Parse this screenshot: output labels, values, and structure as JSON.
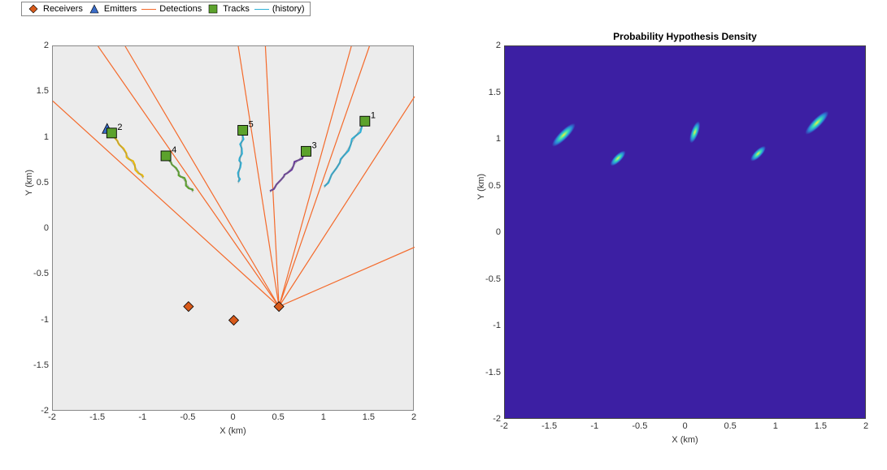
{
  "legend": {
    "items": [
      {
        "label": "Receivers"
      },
      {
        "label": "Emitters"
      },
      {
        "label": "Detections"
      },
      {
        "label": "Tracks"
      },
      {
        "label": "(history)"
      }
    ]
  },
  "left": {
    "xlabel": "X (km)",
    "ylabel": "Y (km)",
    "xticks": [
      "-2",
      "-1.5",
      "-1",
      "-0.5",
      "0",
      "0.5",
      "1",
      "1.5",
      "2"
    ],
    "yticks": [
      "-2",
      "-1.5",
      "-1",
      "-0.5",
      "0",
      "0.5",
      "1",
      "1.5",
      "2"
    ]
  },
  "right": {
    "title": "Probability Hypothesis Density",
    "xlabel": "X (km)",
    "ylabel": "Y (km)",
    "xticks": [
      "-2",
      "-1.5",
      "-1",
      "-0.5",
      "0",
      "0.5",
      "1",
      "1.5",
      "2"
    ],
    "yticks": [
      "-2",
      "-1.5",
      "-1",
      "-0.5",
      "0",
      "0.5",
      "1",
      "1.5",
      "2"
    ]
  },
  "track_labels": [
    "1",
    "2",
    "3",
    "4",
    "5"
  ],
  "chart_data": [
    {
      "type": "scatter",
      "title": "",
      "xlabel": "X (km)",
      "ylabel": "Y (km)",
      "xlim": [
        -2,
        2
      ],
      "ylim": [
        -2,
        2
      ],
      "receivers": [
        {
          "x": -0.5,
          "y": -0.85
        },
        {
          "x": 0.0,
          "y": -1.0
        },
        {
          "x": 0.5,
          "y": -0.85
        }
      ],
      "emitters": [
        {
          "x": -1.4,
          "y": 1.1
        }
      ],
      "tracks": [
        {
          "id": 1,
          "x": 1.45,
          "y": 1.18
        },
        {
          "id": 2,
          "x": -1.35,
          "y": 1.05
        },
        {
          "id": 3,
          "x": 0.8,
          "y": 0.85
        },
        {
          "id": 4,
          "x": -0.75,
          "y": 0.8
        },
        {
          "id": 5,
          "x": 0.1,
          "y": 1.08
        }
      ],
      "history_series": [
        {
          "name": "t1",
          "start": {
            "x": 1.0,
            "y": 0.45
          },
          "end": {
            "x": 1.45,
            "y": 1.18
          },
          "color": "#2fb0d6"
        },
        {
          "name": "t2",
          "start": {
            "x": -1.0,
            "y": 0.55
          },
          "end": {
            "x": -1.35,
            "y": 1.05
          },
          "color": "#e8b90f"
        },
        {
          "name": "t3",
          "start": {
            "x": 0.4,
            "y": 0.4
          },
          "end": {
            "x": 0.8,
            "y": 0.85
          },
          "color": "#6a3d9a"
        },
        {
          "name": "t4",
          "start": {
            "x": -0.45,
            "y": 0.4
          },
          "end": {
            "x": -0.75,
            "y": 0.8
          },
          "color": "#5ca22c"
        },
        {
          "name": "t5",
          "start": {
            "x": 0.05,
            "y": 0.5
          },
          "end": {
            "x": 0.1,
            "y": 1.08
          },
          "color": "#2fb0d6"
        }
      ],
      "detection_rays_origin": {
        "x": 0.5,
        "y": -0.85
      },
      "detection_ray_endpoints": [
        {
          "x": -1.5,
          "y": 2.0
        },
        {
          "x": -1.2,
          "y": 2.0
        },
        {
          "x": 0.05,
          "y": 2.0
        },
        {
          "x": 0.35,
          "y": 2.0
        },
        {
          "x": 1.3,
          "y": 2.0
        },
        {
          "x": 1.5,
          "y": 2.0
        },
        {
          "x": 2.0,
          "y": 1.45
        },
        {
          "x": 2.0,
          "y": -0.2
        },
        {
          "x": -2.0,
          "y": 1.4
        }
      ]
    },
    {
      "type": "heatmap",
      "title": "Probability Hypothesis Density",
      "xlabel": "X (km)",
      "ylabel": "Y (km)",
      "xlim": [
        -2,
        2
      ],
      "ylim": [
        -2,
        2
      ],
      "peaks": [
        {
          "x": 1.45,
          "y": 1.18,
          "angle_deg": -45,
          "sx": 0.22,
          "sy": 0.06
        },
        {
          "x": -1.35,
          "y": 1.05,
          "angle_deg": -45,
          "sx": 0.22,
          "sy": 0.06
        },
        {
          "x": 0.8,
          "y": 0.85,
          "angle_deg": -45,
          "sx": 0.14,
          "sy": 0.05
        },
        {
          "x": -0.75,
          "y": 0.8,
          "angle_deg": -45,
          "sx": 0.14,
          "sy": 0.05
        },
        {
          "x": 0.1,
          "y": 1.08,
          "angle_deg": -70,
          "sx": 0.16,
          "sy": 0.05
        }
      ]
    }
  ]
}
